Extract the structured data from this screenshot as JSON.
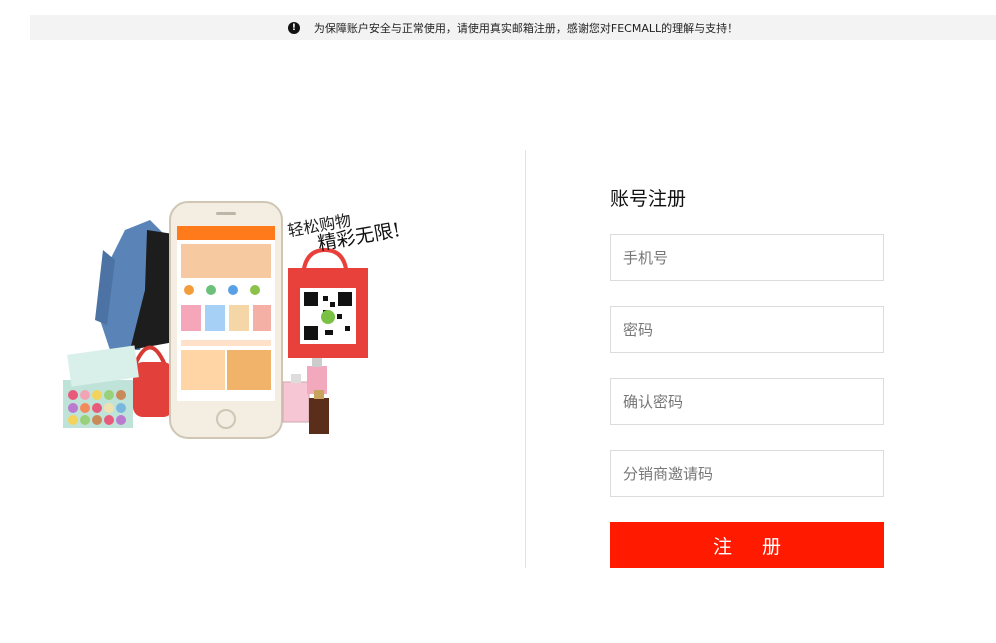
{
  "notice": {
    "icon": "exclamation-circle-icon",
    "text": "为保障账户安全与正常使用，请使用真实邮箱注册，感谢您对FECMALL的理解与支持！"
  },
  "promo": {
    "slogan_line1": "轻松购物",
    "slogan_line2": "精彩无限!"
  },
  "form": {
    "title": "账号注册",
    "phone_placeholder": "手机号",
    "password_placeholder": "密码",
    "confirm_password_placeholder": "确认密码",
    "invite_code_placeholder": "分销商邀请码",
    "submit_label": "注 册"
  },
  "colors": {
    "accent": "#ff1a00",
    "notice_bg": "#f3f3f3",
    "border": "#dcdcdc"
  }
}
